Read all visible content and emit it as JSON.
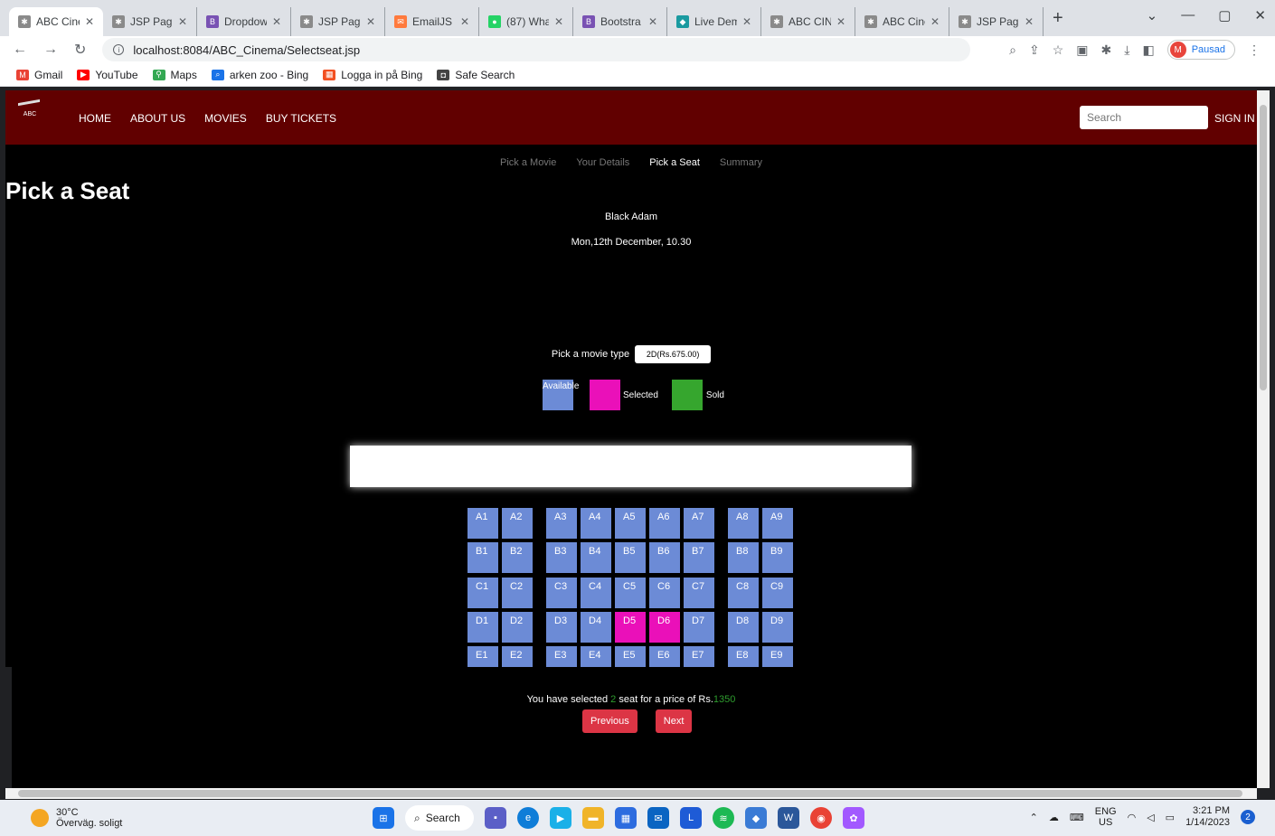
{
  "browser": {
    "tabs": [
      {
        "title": "ABC Cine",
        "active": true,
        "icon": "abc-favicon"
      },
      {
        "title": "JSP Page",
        "active": false,
        "icon": "abc-favicon"
      },
      {
        "title": "Dropdow",
        "active": false,
        "icon": "bootstrap-favicon"
      },
      {
        "title": "JSP Page",
        "active": false,
        "icon": "abc-favicon"
      },
      {
        "title": "EmailJS",
        "active": false,
        "icon": "emailjs-favicon"
      },
      {
        "title": "(87) Wha",
        "active": false,
        "icon": "whatsapp-favicon"
      },
      {
        "title": "Bootstra",
        "active": false,
        "icon": "bootstrap-favicon"
      },
      {
        "title": "Live Dem",
        "active": false,
        "icon": "live-demo-favicon"
      },
      {
        "title": "ABC CINE",
        "active": false,
        "icon": "abc-favicon"
      },
      {
        "title": "ABC Cine",
        "active": false,
        "icon": "abc-favicon"
      },
      {
        "title": "JSP Page",
        "active": false,
        "icon": "abc-favicon"
      }
    ],
    "url": "localhost:8084/ABC_Cinema/Selectseat.jsp",
    "profile_initial": "M",
    "profile_label": "Pausad",
    "bookmarks": [
      {
        "label": "Gmail",
        "icon": "gmail-icon"
      },
      {
        "label": "YouTube",
        "icon": "youtube-icon"
      },
      {
        "label": "Maps",
        "icon": "maps-icon"
      },
      {
        "label": "arken zoo - Bing",
        "icon": "search-icon"
      },
      {
        "label": "Logga in på Bing",
        "icon": "windows-icon"
      },
      {
        "label": "Safe Search",
        "icon": "safe-search-icon"
      }
    ]
  },
  "site": {
    "nav": [
      "HOME",
      "ABOUT US",
      "MOVIES",
      "BUY TICKETS"
    ],
    "logo_text": "ABC",
    "search_placeholder": "Search",
    "signin": "SIGN IN"
  },
  "steps": {
    "step1": "Pick a Movie",
    "step2": "Your Details",
    "step3": "Pick a Seat",
    "step4": "Summary"
  },
  "page": {
    "title": "Pick a Seat",
    "movie": "Black Adam",
    "datetime": "Mon,12th December, 10.30",
    "type_label": "Pick a movie type",
    "type_value": "2D(Rs.675.00)"
  },
  "legend": {
    "available": "Available",
    "selected": "Selected",
    "sold": "Sold"
  },
  "colors": {
    "available": "#6c8bd6",
    "selected": "#ea10b9",
    "sold": "#36a62e",
    "navbar": "#610000",
    "button": "#dc3545"
  },
  "seats": {
    "rows": [
      "A",
      "B",
      "C",
      "D",
      "E"
    ],
    "columns": [
      1,
      2,
      3,
      4,
      5,
      6,
      7,
      8,
      9
    ],
    "selected": [
      "D5",
      "D6"
    ]
  },
  "summary": {
    "prefix": "You have selected ",
    "count": "2",
    "middle": " seat for a price of Rs.",
    "price": "1350"
  },
  "buttons": {
    "previous": "Previous",
    "next": "Next"
  },
  "taskbar": {
    "temperature": "30°C",
    "weather": "Överväg. soligt",
    "search": "Search",
    "lang_top": "ENG",
    "lang_bottom": "US",
    "time": "3:21 PM",
    "date": "1/14/2023",
    "notifications": "2"
  }
}
